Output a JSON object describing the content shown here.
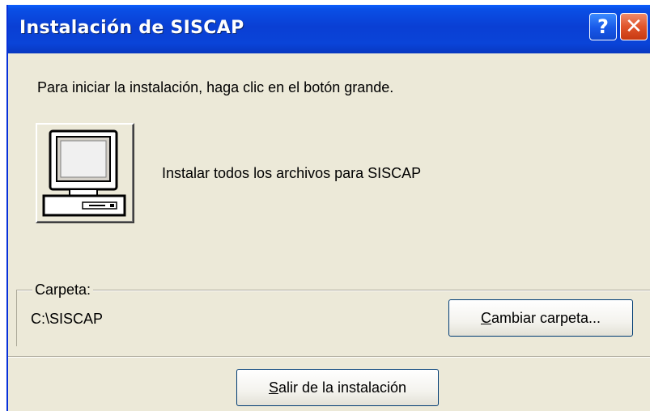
{
  "window": {
    "title": "Instalación de SISCAP",
    "help_glyph": "?",
    "close_glyph": "✕"
  },
  "content": {
    "instruction": "Para iniciar la instalación, haga clic en el botón grande.",
    "install_label": "Instalar todos los archivos para SISCAP",
    "install_icon": "computer-icon"
  },
  "folder": {
    "legend": "Carpeta:",
    "path": "C:\\SISCAP",
    "change_label_accel": "C",
    "change_label_rest": "ambiar carpeta..."
  },
  "footer": {
    "exit_label_accel": "S",
    "exit_label_rest": "alir de la instalación"
  },
  "colors": {
    "titlebar": "#0a3fd4",
    "window_bg": "#ece9d8",
    "close_button": "#e0542a"
  }
}
